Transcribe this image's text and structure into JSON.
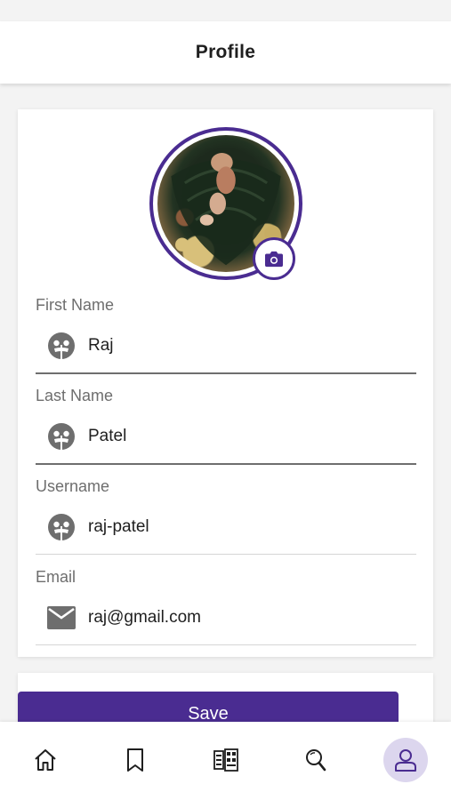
{
  "header": {
    "title": "Profile"
  },
  "colors": {
    "accent": "#4a2c91",
    "active_nav_bg": "#dcd6ee",
    "label": "#6e6e6e"
  },
  "profile": {
    "avatar_icon": "profile-photo",
    "camera_icon": "camera-icon",
    "fields": [
      {
        "label": "First Name",
        "value": "Raj",
        "icon": "user-face-icon"
      },
      {
        "label": "Last Name",
        "value": "Patel",
        "icon": "user-face-icon"
      },
      {
        "label": "Username",
        "value": "raj-patel",
        "icon": "user-face-icon"
      },
      {
        "label": "Email",
        "value": "raj@gmail.com",
        "icon": "envelope-icon"
      }
    ]
  },
  "actions": {
    "save_label": "Save"
  },
  "bottom_nav": {
    "items": [
      {
        "icon": "home-icon",
        "active": false
      },
      {
        "icon": "bookmark-icon",
        "active": false
      },
      {
        "icon": "news-grid-icon",
        "active": false
      },
      {
        "icon": "search-icon",
        "active": false
      },
      {
        "icon": "profile-icon",
        "active": true
      }
    ]
  }
}
